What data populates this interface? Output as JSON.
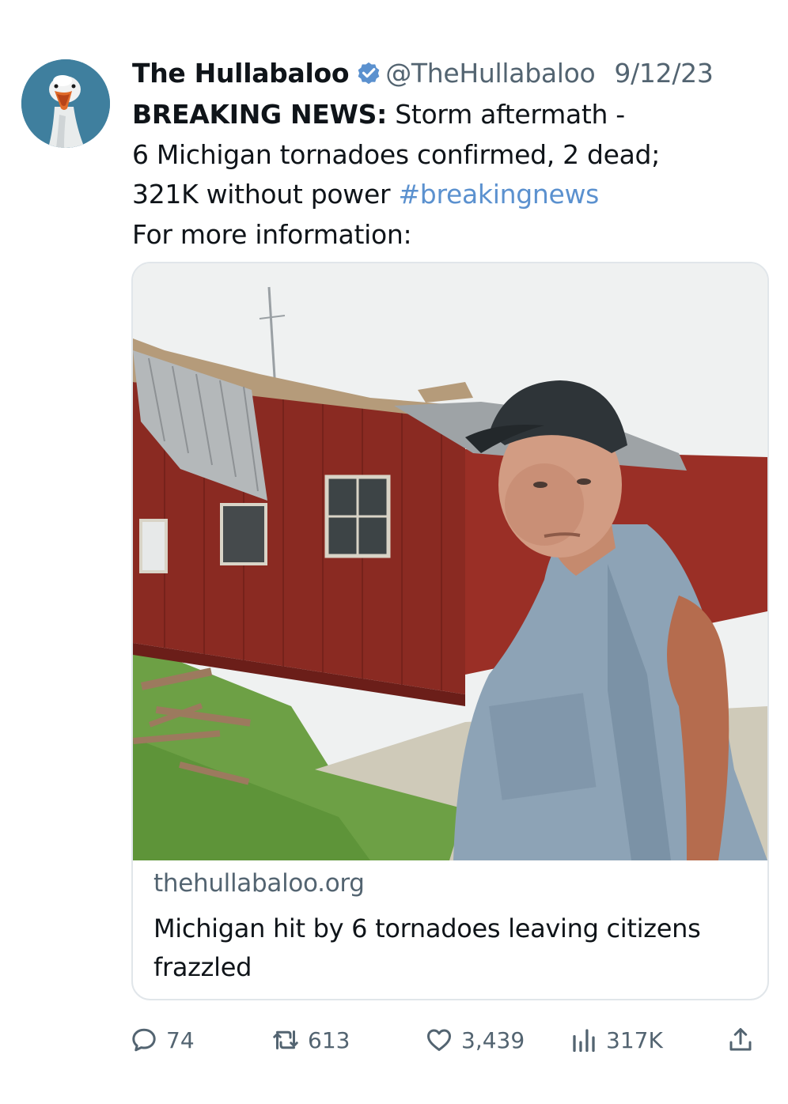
{
  "tweet": {
    "display_name": "The Hullabaloo",
    "handle": "@TheHullabaloo",
    "date": "9/12/23",
    "verified_icon": "verified-badge-icon",
    "avatar_icon": "goose-avatar",
    "text": {
      "breaking_label": "BREAKING NEWS:",
      "line1_rest": " Storm aftermath -",
      "line2": "6 Michigan tornadoes confirmed, 2 dead;",
      "line3_text": "321K without power ",
      "hashtag": "#breakingnews",
      "line4": "For more information:"
    },
    "card": {
      "domain": "thehullabaloo.org",
      "title": "Michigan hit by 6 tornadoes leaving citizens frazzled"
    },
    "stats": {
      "replies": "74",
      "retweets": "613",
      "likes": "3,439",
      "views": "317K"
    }
  },
  "colors": {
    "text": "#0f1419",
    "secondary": "#536471",
    "hashtag": "#5b91cf",
    "verified": "#5b91cf",
    "card_border": "#e1e6ea"
  }
}
